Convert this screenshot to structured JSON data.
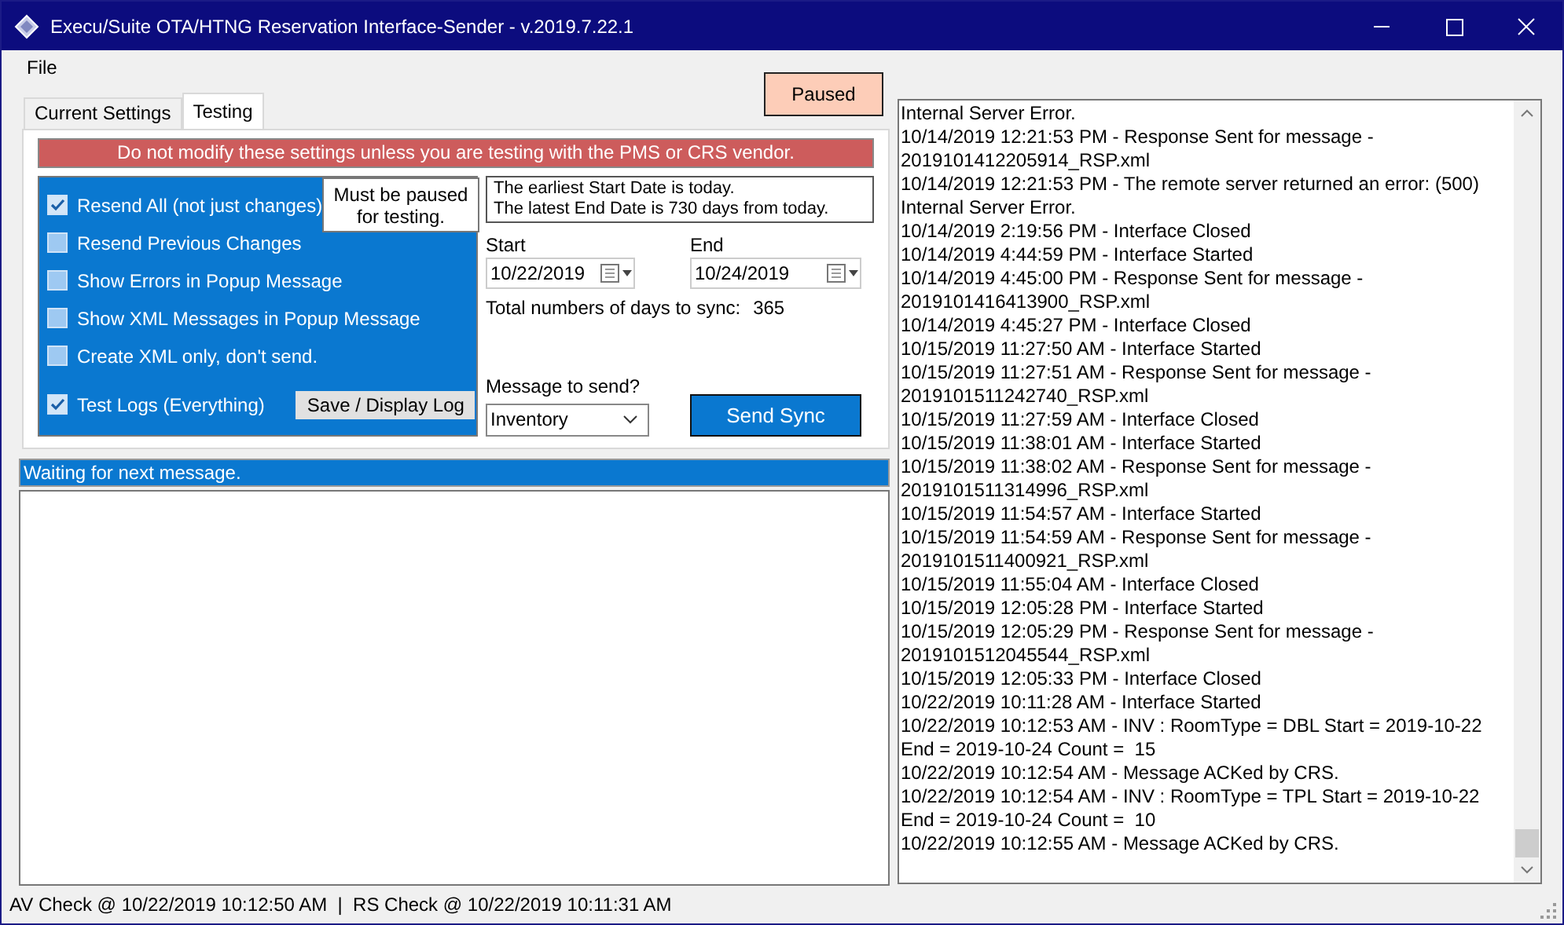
{
  "window": {
    "title": "Execu/Suite OTA/HTNG Reservation Interface-Sender - v.2019.7.22.1"
  },
  "menu": [
    "File"
  ],
  "paused_button": "Paused",
  "tabs": [
    {
      "label": "Current Settings",
      "selected": false
    },
    {
      "label": "Testing",
      "selected": true
    }
  ],
  "warning": "Do not modify these settings unless you are testing with the PMS or CRS vendor.",
  "options": [
    {
      "label": "Resend All (not just changes)",
      "checked": true
    },
    {
      "label": "Resend Previous Changes",
      "checked": false
    },
    {
      "label": "Show Errors in Popup Message",
      "checked": false
    },
    {
      "label": "Show XML Messages in Popup Message",
      "checked": false
    },
    {
      "label": "Create XML only, don't send.",
      "checked": false
    },
    {
      "label": "Test Logs (Everything)",
      "checked": true
    }
  ],
  "pause_note": "Must be paused\nfor testing.",
  "save_log_button": "Save / Display Log",
  "date_info": [
    "The earliest Start Date is today.",
    "The latest End Date is 730 days from today."
  ],
  "start": {
    "label": "Start",
    "value": "10/22/2019"
  },
  "end": {
    "label": "End",
    "value": "10/24/2019"
  },
  "total_days": {
    "label": "Total numbers of days to sync:",
    "value": "365"
  },
  "message": {
    "label": "Message to send?",
    "value": "Inventory"
  },
  "send_button": "Send Sync",
  "status_message": "Waiting for next message.",
  "log": [
    "Internal Server Error.",
    "10/14/2019 12:21:53 PM - Response Sent for message -",
    "2019101412205914_RSP.xml",
    "10/14/2019 12:21:53 PM - The remote server returned an error: (500)",
    "Internal Server Error.",
    "10/14/2019 2:19:56 PM - Interface Closed",
    "10/14/2019 4:44:59 PM - Interface Started",
    "10/14/2019 4:45:00 PM - Response Sent for message -",
    "2019101416413900_RSP.xml",
    "10/14/2019 4:45:27 PM - Interface Closed",
    "10/15/2019 11:27:50 AM - Interface Started",
    "10/15/2019 11:27:51 AM - Response Sent for message -",
    "2019101511242740_RSP.xml",
    "10/15/2019 11:27:59 AM - Interface Closed",
    "10/15/2019 11:38:01 AM - Interface Started",
    "10/15/2019 11:38:02 AM - Response Sent for message -",
    "2019101511314996_RSP.xml",
    "10/15/2019 11:54:57 AM - Interface Started",
    "10/15/2019 11:54:59 AM - Response Sent for message -",
    "2019101511400921_RSP.xml",
    "10/15/2019 11:55:04 AM - Interface Closed",
    "10/15/2019 12:05:28 PM - Interface Started",
    "10/15/2019 12:05:29 PM - Response Sent for message -",
    "2019101512045544_RSP.xml",
    "10/15/2019 12:05:33 PM - Interface Closed",
    "10/22/2019 10:11:28 AM - Interface Started",
    "10/22/2019 10:12:53 AM - INV : RoomType = DBL Start = 2019-10-22",
    "End = 2019-10-24 Count =  15",
    "10/22/2019 10:12:54 AM - Message ACKed by CRS.",
    "10/22/2019 10:12:54 AM - INV : RoomType = TPL Start = 2019-10-22",
    "End = 2019-10-24 Count =  10",
    "10/22/2019 10:12:55 AM - Message ACKed by CRS."
  ],
  "status_bar": "AV Check @ 10/22/2019 10:12:50 AM  |  RS Check @ 10/22/2019 10:11:31 AM"
}
